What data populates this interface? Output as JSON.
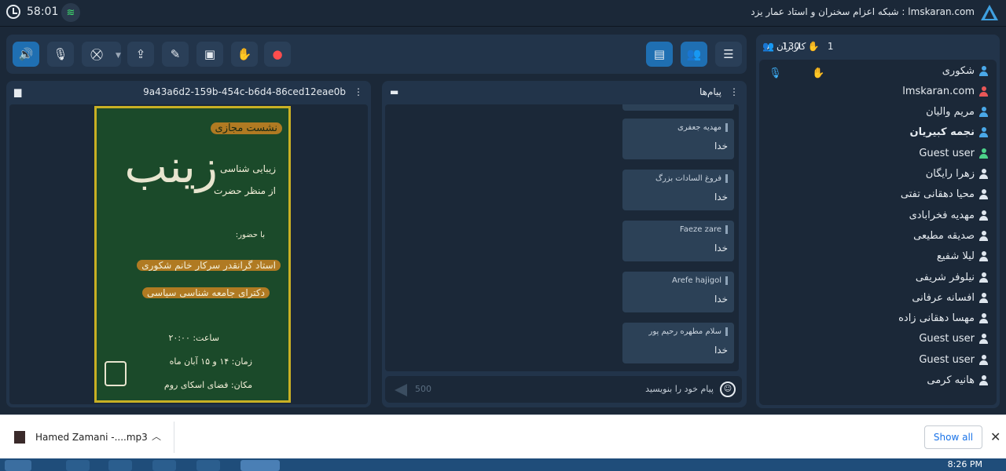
{
  "top": {
    "time": "58:01",
    "brand": "lmskaran.com : شبکه اعزام سخنران و استاد عمار یزد"
  },
  "toolbar": {
    "icons": [
      "speaker-icon",
      "mic-muted-icon",
      "camera-off-icon",
      "screen-share-icon",
      "brush-icon",
      "whiteboard-icon",
      "raise-hand-icon",
      "record-icon",
      "chat-toggle-icon",
      "users-toggle-icon",
      "menu-icon"
    ]
  },
  "users": {
    "title": "کاربران",
    "count": "130",
    "hands": "1",
    "list": [
      {
        "name": "شکوری",
        "color": "blue",
        "bold": false
      },
      {
        "name": "lmskaran.com",
        "color": "red",
        "bold": false
      },
      {
        "name": "مریم والیان",
        "color": "blue",
        "bold": false
      },
      {
        "name": "نجمه کبیریان",
        "color": "blue",
        "bold": true
      },
      {
        "name": "Guest user",
        "color": "green",
        "bold": false
      },
      {
        "name": "زهرا رایگان",
        "color": "white",
        "bold": false
      },
      {
        "name": "محیا دهقانی تفتی",
        "color": "white",
        "bold": false
      },
      {
        "name": "مهدیه فخرابادی",
        "color": "white",
        "bold": false
      },
      {
        "name": "صدیقه مطیعی",
        "color": "white",
        "bold": false
      },
      {
        "name": "لیلا شفیع",
        "color": "white",
        "bold": false
      },
      {
        "name": "نیلوفر شریفی",
        "color": "white",
        "bold": false
      },
      {
        "name": "افسانه عرفانی",
        "color": "white",
        "bold": false
      },
      {
        "name": "مهسا دهقانی زاده",
        "color": "white",
        "bold": false
      },
      {
        "name": "Guest user",
        "color": "white",
        "bold": false
      },
      {
        "name": "Guest user",
        "color": "white",
        "bold": false
      },
      {
        "name": "هانیه کرمی",
        "color": "white",
        "bold": false
      }
    ]
  },
  "chat": {
    "title": "پیام‌ها",
    "placeholder": "پیام خود را بنویسید",
    "counter": "500",
    "messages": [
      {
        "name": "مهدیه جعفری",
        "text": "خدا"
      },
      {
        "name": "فروغ السادات بزرگ",
        "text": "خدا"
      },
      {
        "name": "Faeze zare",
        "text": "خدا"
      },
      {
        "name": "Arefe hajigol",
        "text": "خدا"
      },
      {
        "name": "سلام مطهره رحیم پور",
        "text": "خدا"
      }
    ]
  },
  "presentation": {
    "file_id": "9a43a6d2-159b-454c-b6d4-86ced12eae0b",
    "poster": {
      "tag": "نشست مجازی",
      "big": "زینب",
      "sub1": "زیبایی شناسی",
      "sub2": "از منظر حضرت",
      "with": "با حضور:",
      "speaker": "استاد گرانقدر سرکار خانم شکوری",
      "degree": "دکترای جامعه شناسی سیاسی",
      "time": "ساعت: ۲۰:۰۰",
      "date": "زمان: ۱۴ و ۱۵ آبان ماه",
      "place": "مکان: فضای اسکای روم"
    }
  },
  "downloads": {
    "file": "Hamed Zamani -....mp3",
    "show_all": "Show all"
  },
  "taskbar": {
    "time": "8:26 PM"
  }
}
